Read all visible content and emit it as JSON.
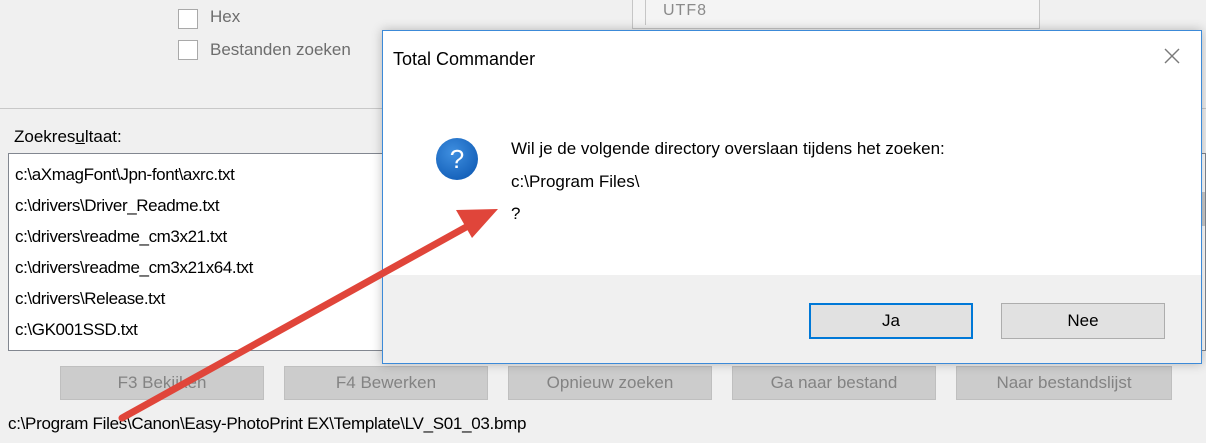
{
  "options": {
    "hex_label": "Hex",
    "search_files_label": "Bestanden zoeken",
    "encoding_value": "UTF8"
  },
  "results": {
    "label_before": "Zoekres",
    "label_underlined": "u",
    "label_after": "ltaat:",
    "items": [
      "c:\\aXmagFont\\Jpn-font\\axrc.txt",
      "c:\\drivers\\Driver_Readme.txt",
      "c:\\drivers\\readme_cm3x21.txt",
      "c:\\drivers\\readme_cm3x21x64.txt",
      "c:\\drivers\\Release.txt",
      "c:\\GK001SSD.txt"
    ]
  },
  "buttons": {
    "view": "F3 Bekijken",
    "edit": "F4 Bewerken",
    "search_again": "Opnieuw zoeken",
    "goto_file": "Ga naar bestand",
    "to_listbox": "Naar bestandslijst"
  },
  "status": {
    "path": "c:\\Program Files\\Canon\\Easy-PhotoPrint EX\\Template\\LV_S01_03.bmp"
  },
  "dialog": {
    "title": "Total Commander",
    "message_line1": "Wil je de volgende directory overslaan tijdens het zoeken:",
    "message_line2": "c:\\Program Files\\",
    "message_line3": "?",
    "yes_label": "Ja",
    "no_label": "Nee",
    "icon": "question-icon",
    "accent_color": "#0078d7"
  },
  "annotation": {
    "arrow_color": "#e0453a"
  }
}
